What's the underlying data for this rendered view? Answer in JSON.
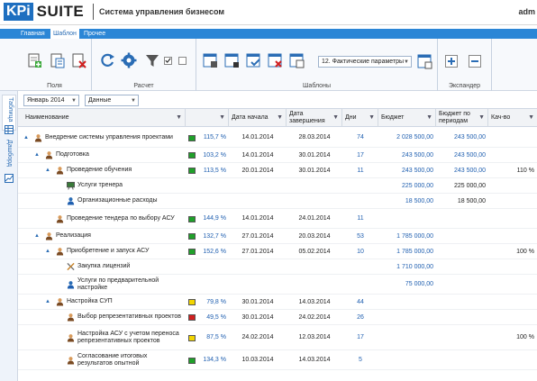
{
  "header": {
    "logo_kpi": "KPi",
    "logo_suite": "SUITE",
    "subtitle": "Система управления бизнесом",
    "user": "adm"
  },
  "ribbon": {
    "tabs": [
      {
        "label": "Главная",
        "active": false
      },
      {
        "label": "Шаблон",
        "active": true
      },
      {
        "label": "Прочее",
        "active": false
      }
    ],
    "groups": [
      {
        "label": "Поля"
      },
      {
        "label": "Расчет"
      },
      {
        "label": "Шаблоны"
      },
      {
        "label": "Экспандер"
      }
    ],
    "param_select": "12. Фактические параметры"
  },
  "side_tabs": [
    {
      "label": "Таблица"
    },
    {
      "label": "Дашборд"
    }
  ],
  "filters": {
    "period": "Январь 2014",
    "mode": "Данные"
  },
  "columns": {
    "name": "Наименование",
    "start": "Дата начала",
    "end": "Дата завершения",
    "days": "Дни",
    "budget": "Бюджет",
    "budget_periods": "Бюджет по периодам",
    "quality": "Кач-во"
  },
  "colors": {
    "green": "#1fa02a",
    "red": "#d11f1f",
    "yellow": "#f2d500",
    "accent": "#2b86d6"
  },
  "rows": [
    {
      "level": 0,
      "exp": true,
      "icon": "person",
      "name": "Внедрение системы управления проектами",
      "ind": "green",
      "pct": "115,7 %",
      "start": "14.01.2014",
      "end": "28.03.2014",
      "days": "74",
      "budget": "2 028 500,00",
      "bp": "243 500,00",
      "q": ""
    },
    {
      "level": 1,
      "exp": true,
      "icon": "person",
      "name": "Подготовка",
      "ind": "green",
      "pct": "103,2 %",
      "start": "14.01.2014",
      "end": "30.01.2014",
      "days": "17",
      "budget": "243 500,00",
      "bp": "243 500,00",
      "q": ""
    },
    {
      "level": 2,
      "exp": true,
      "icon": "person",
      "name": "Проведение обучения",
      "ind": "green",
      "pct": "113,5 %",
      "start": "20.01.2014",
      "end": "30.01.2014",
      "days": "11",
      "budget": "243 500,00",
      "bp": "243 500,00",
      "q": "110 %"
    },
    {
      "level": 3,
      "exp": false,
      "icon": "board",
      "name": "Услуги тренера",
      "ind": "",
      "pct": "",
      "start": "",
      "end": "",
      "days": "",
      "budget": "225 000,00",
      "bp": "225 000,00",
      "q": ""
    },
    {
      "level": 3,
      "exp": false,
      "icon": "service",
      "name": "Организационные расходы",
      "ind": "",
      "pct": "",
      "start": "",
      "end": "",
      "days": "",
      "budget": "18 500,00",
      "bp": "18 500,00",
      "q": ""
    },
    {
      "level": 2,
      "exp": false,
      "icon": "person",
      "name": "Проведение тендера по выбору АСУ",
      "ind": "green",
      "pct": "144,9 %",
      "start": "14.01.2014",
      "end": "24.01.2014",
      "days": "11",
      "budget": "",
      "bp": "",
      "q": ""
    },
    {
      "level": 1,
      "exp": true,
      "icon": "person",
      "name": "Реализация",
      "ind": "green",
      "pct": "132,7 %",
      "start": "27.01.2014",
      "end": "20.03.2014",
      "days": "53",
      "budget": "1 785 000,00",
      "bp": "",
      "q": ""
    },
    {
      "level": 2,
      "exp": true,
      "icon": "person",
      "name": "Приобретение и запуск АСУ",
      "ind": "green",
      "pct": "152,6 %",
      "start": "27.01.2014",
      "end": "05.02.2014",
      "days": "10",
      "budget": "1 785 000,00",
      "bp": "",
      "q": "100 %"
    },
    {
      "level": 3,
      "exp": false,
      "icon": "tools",
      "name": "Закупка лицензий",
      "ind": "",
      "pct": "",
      "start": "",
      "end": "",
      "days": "",
      "budget": "1 710 000,00",
      "bp": "",
      "q": ""
    },
    {
      "level": 3,
      "exp": false,
      "icon": "service",
      "name": "Услуги по предварительной настройке",
      "ind": "",
      "pct": "",
      "start": "",
      "end": "",
      "days": "",
      "budget": "75 000,00",
      "bp": "",
      "q": ""
    },
    {
      "level": 2,
      "exp": true,
      "icon": "person",
      "name": "Настройка СУП",
      "ind": "yellow",
      "pct": "79,8 %",
      "start": "30.01.2014",
      "end": "14.03.2014",
      "days": "44",
      "budget": "",
      "bp": "",
      "q": ""
    },
    {
      "level": 3,
      "exp": false,
      "icon": "person",
      "name": "Выбор репрезентативных проектов",
      "ind": "red",
      "pct": "49,5 %",
      "start": "30.01.2014",
      "end": "24.02.2014",
      "days": "26",
      "budget": "",
      "bp": "",
      "q": ""
    },
    {
      "level": 3,
      "exp": false,
      "icon": "person",
      "name": "Настройка АСУ с учетом переноса репрезентативных проектов",
      "ind": "yellow",
      "pct": "87,5 %",
      "start": "24.02.2014",
      "end": "12.03.2014",
      "days": "17",
      "budget": "",
      "bp": "",
      "q": "100 %"
    },
    {
      "level": 3,
      "exp": false,
      "icon": "person",
      "name": "Согласование итоговых результатов опытной",
      "ind": "green",
      "pct": "134,3 %",
      "start": "10.03.2014",
      "end": "14.03.2014",
      "days": "5",
      "budget": "",
      "bp": "",
      "q": ""
    }
  ]
}
